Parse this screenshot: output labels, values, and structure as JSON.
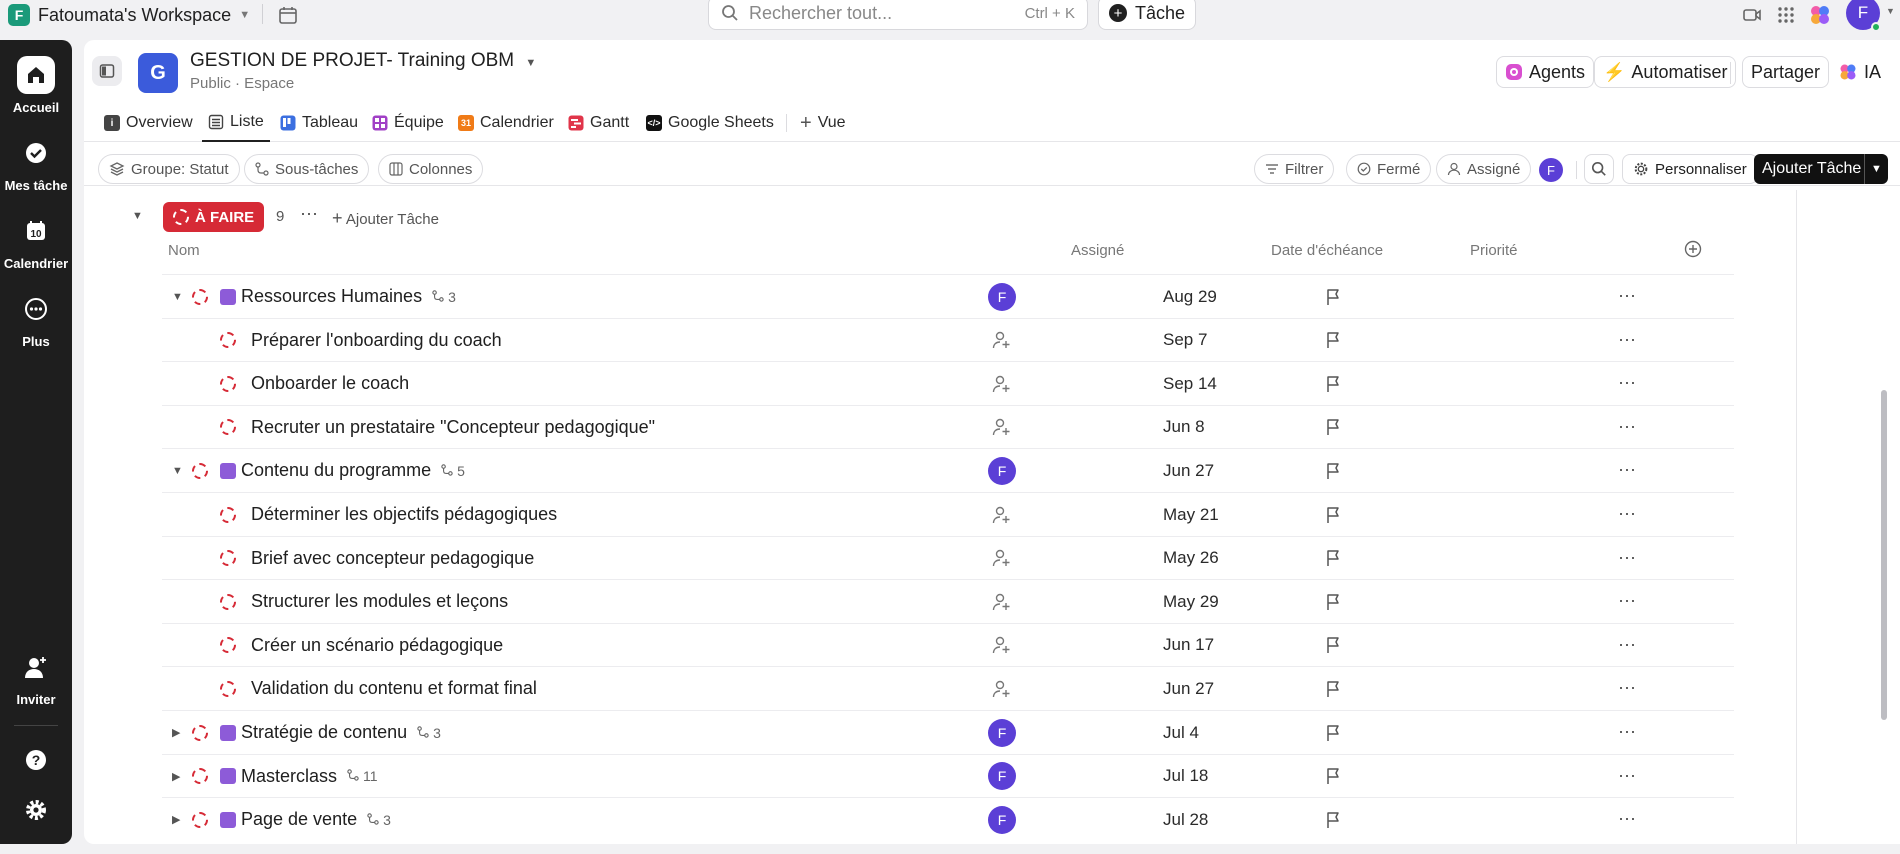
{
  "topbar": {
    "workspace_initial": "F",
    "workspace_name": "Fatoumata's Workspace",
    "search_placeholder": "Rechercher tout...",
    "search_shortcut": "Ctrl + K",
    "task_button": "Tâche",
    "user_initial": "F"
  },
  "sidebar": {
    "items": [
      {
        "label": "Accueil",
        "icon": "home-icon"
      },
      {
        "label": "Mes tâche",
        "icon": "check-circle-icon"
      },
      {
        "label": "Calendrier",
        "icon": "calendar-icon",
        "day": "10"
      },
      {
        "label": "Plus",
        "icon": "more-circle-icon"
      },
      {
        "label": "Inviter",
        "icon": "invite-icon"
      }
    ]
  },
  "header": {
    "space_initial": "G",
    "title": "GESTION DE PROJET- Training OBM",
    "subtitle": "Public · Espace",
    "agents": "Agents",
    "automate": "Automatiser",
    "share": "Partager",
    "ai": "IA"
  },
  "views": [
    {
      "label": "Overview"
    },
    {
      "label": "Liste"
    },
    {
      "label": "Tableau"
    },
    {
      "label": "Équipe"
    },
    {
      "label": "Calendrier"
    },
    {
      "label": "Gantt"
    },
    {
      "label": "Google Sheets"
    },
    {
      "label": "Vue"
    }
  ],
  "filters": {
    "group": "Groupe: Statut",
    "subtasks": "Sous-tâches",
    "columns": "Colonnes",
    "filter": "Filtrer",
    "closed": "Fermé",
    "assigned": "Assigné",
    "user_initial": "F",
    "customize": "Personnaliser",
    "add_task": "Ajouter Tâche"
  },
  "group": {
    "status": "À FAIRE",
    "count": "9",
    "add_task": "Ajouter Tâche"
  },
  "columns": {
    "name": "Nom",
    "assignee": "Assigné",
    "due": "Date d'échéance",
    "priority": "Priorité"
  },
  "tasks": [
    {
      "name": "Ressources Humaines",
      "subcount": "3",
      "assignee": "F",
      "due": "Aug 29",
      "level": 0,
      "expanded": true
    },
    {
      "name": "Préparer l'onboarding du coach",
      "due": "Sep 7",
      "level": 1
    },
    {
      "name": "Onboarder le coach",
      "due": "Sep 14",
      "level": 1
    },
    {
      "name": "Recruter un prestataire \"Concepteur pedagogique\"",
      "due": "Jun 8",
      "level": 1
    },
    {
      "name": "Contenu du programme",
      "subcount": "5",
      "assignee": "F",
      "due": "Jun 27",
      "level": 0,
      "expanded": true
    },
    {
      "name": "Déterminer les objectifs pédagogiques",
      "due": "May 21",
      "level": 1
    },
    {
      "name": "Brief avec concepteur pedagogique",
      "due": "May 26",
      "level": 1
    },
    {
      "name": "Structurer les modules et leçons",
      "due": "May 29",
      "level": 1
    },
    {
      "name": "Créer un scénario pédagogique",
      "due": "Jun 17",
      "level": 1
    },
    {
      "name": "Validation du contenu et format final",
      "due": "Jun 27",
      "level": 1
    },
    {
      "name": "Stratégie de contenu",
      "subcount": "3",
      "assignee": "F",
      "due": "Jul 4",
      "level": 0,
      "expanded": false
    },
    {
      "name": "Masterclass",
      "subcount": "11",
      "assignee": "F",
      "due": "Jul 18",
      "level": 0,
      "expanded": false
    },
    {
      "name": "Page de vente",
      "subcount": "3",
      "assignee": "F",
      "due": "Jul 28",
      "level": 0,
      "expanded": false
    }
  ],
  "colors": {
    "status_red": "#d62a36",
    "accent_purple": "#5b3fd6",
    "task_square": "#8d5bd8",
    "space_blue": "#3b5bdb"
  }
}
